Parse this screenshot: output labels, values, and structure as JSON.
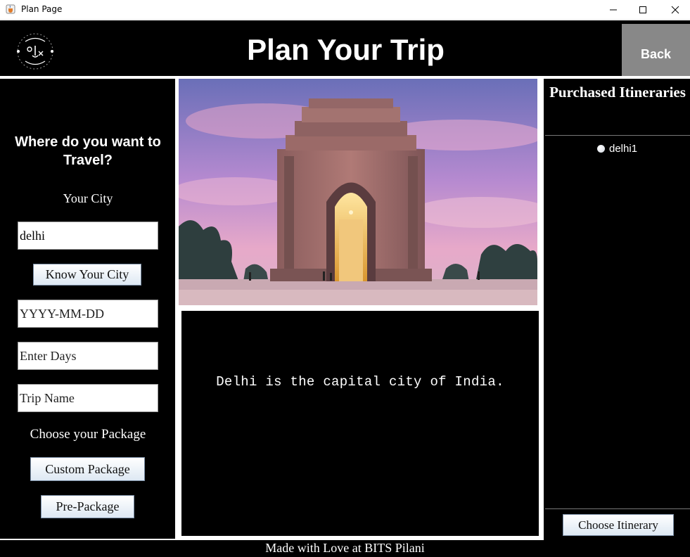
{
  "window": {
    "title": "Plan Page",
    "icon": "java-cup-icon"
  },
  "header": {
    "title": "Plan Your Trip",
    "back_label": "Back",
    "logo_text": "Journey Genius",
    "logo_subtext": "Itinerary Planner for All",
    "logo_mark": "0|J|x"
  },
  "left_panel": {
    "question": "Where do you want to Travel?",
    "city_label": "Your City",
    "city_value": "delhi",
    "know_city_label": "Know Your City",
    "date_placeholder": "YYYY-MM-DD",
    "days_placeholder": "Enter Days",
    "trip_name_placeholder": "Trip Name",
    "package_label": "Choose your Package",
    "custom_package_label": "Custom Package",
    "pre_package_label": "Pre-Package"
  },
  "main": {
    "image_subject": "India Gate",
    "city_info": "Delhi is the capital city of India."
  },
  "right_panel": {
    "title": "Purchased Itineraries",
    "items": [
      "delhi1"
    ],
    "choose_label": "Choose Itinerary"
  },
  "footer": {
    "text": "Made with Love at BITS Pilani"
  },
  "colors": {
    "panel_bg": "#000000",
    "back_button": "#888888",
    "text": "#ffffff"
  }
}
